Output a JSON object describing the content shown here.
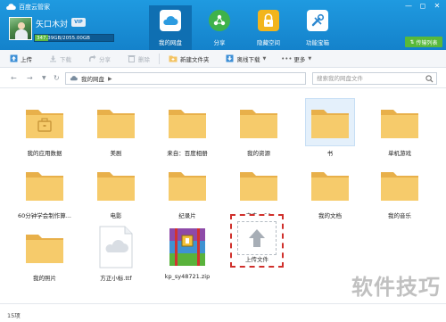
{
  "app": {
    "title": "百度云管家"
  },
  "window_controls": [
    "—",
    "◻",
    "✕"
  ],
  "user": {
    "name": "矢口木対",
    "badge": "VIP",
    "storage_text": "347.39GB/2055.00GB",
    "storage_fraction": 0.17
  },
  "nav": {
    "tabs": [
      {
        "label": "我的网盘",
        "icon": "cloud-icon",
        "active": true
      },
      {
        "label": "分享",
        "icon": "share-icon",
        "active": false
      },
      {
        "label": "隐藏空间",
        "icon": "lock-icon",
        "active": false
      },
      {
        "label": "功能宝箱",
        "icon": "toolbox-icon",
        "active": false
      }
    ],
    "transfer_label": "传输列表"
  },
  "toolbar": {
    "upload": "上传",
    "download": "下载",
    "share": "分享",
    "delete": "删除",
    "new_folder": "新建文件夹",
    "offline_download": "离线下载",
    "more": "更多"
  },
  "address": {
    "path": "我的网盘",
    "search_placeholder": "搜索我的网盘文件"
  },
  "files": [
    {
      "name": "我的应用数据",
      "type": "folder",
      "selected": false,
      "briefcase": true
    },
    {
      "name": "美剧",
      "type": "folder",
      "selected": false
    },
    {
      "name": "来自：百度相册",
      "type": "folder",
      "selected": false
    },
    {
      "name": "我的资源",
      "type": "folder",
      "selected": false
    },
    {
      "name": "书",
      "type": "folder",
      "selected": true
    },
    {
      "name": "单机游戏",
      "type": "folder",
      "selected": false
    },
    {
      "name": "60分钟学会制作算...",
      "type": "folder",
      "selected": false
    },
    {
      "name": "电影",
      "type": "folder",
      "selected": false
    },
    {
      "name": "纪录片",
      "type": "folder",
      "selected": false
    },
    {
      "name": "来自：Q1",
      "type": "folder",
      "selected": false
    },
    {
      "name": "我的文档",
      "type": "folder",
      "selected": false
    },
    {
      "name": "我的音乐",
      "type": "folder",
      "selected": false
    },
    {
      "name": "我的照片",
      "type": "folder",
      "selected": false
    },
    {
      "name": "方正小标.ttf",
      "type": "font",
      "selected": false
    },
    {
      "name": "kp_sy48721.zip",
      "type": "zip",
      "selected": false
    }
  ],
  "upload_tile": {
    "label": "上传文件"
  },
  "status": {
    "count": "15项"
  },
  "watermark": "软件技巧",
  "colors": {
    "header": "#1a8cd8",
    "folder": "#f3c465",
    "highlight": "#d0302c",
    "transfer": "#58b93a"
  }
}
